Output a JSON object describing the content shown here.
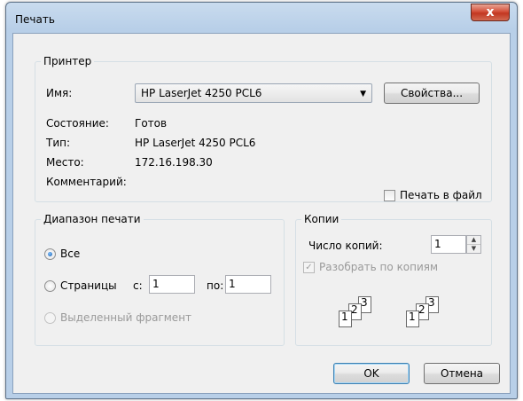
{
  "window": {
    "title": "Печать",
    "close_label": "x"
  },
  "printer": {
    "legend": "Принтер",
    "name_label": "Имя:",
    "name_value": "HP LaserJet 4250 PCL6",
    "properties_button": "Свойства...",
    "status_label": "Состояние:",
    "status_value": "Готов",
    "type_label": "Тип:",
    "type_value": "HP LaserJet 4250 PCL6",
    "location_label": "Место:",
    "location_value": "172.16.198.30",
    "comment_label": "Комментарий:",
    "print_to_file_label": "Печать в файл"
  },
  "range": {
    "legend": "Диапазон печати",
    "all_label": "Все",
    "pages_label": "Страницы",
    "from_label": "с:",
    "from_value": "1",
    "to_label": "по:",
    "to_value": "1",
    "selection_label": "Выделенный фрагмент",
    "selected": "all"
  },
  "copies": {
    "legend": "Копии",
    "count_label": "Число копий:",
    "count_value": "1",
    "collate_label": "Разобрать по копиям",
    "collate_checked": true,
    "sheet_labels": [
      "1",
      "2",
      "3"
    ]
  },
  "buttons": {
    "ok": "OK",
    "cancel": "Отмена"
  }
}
